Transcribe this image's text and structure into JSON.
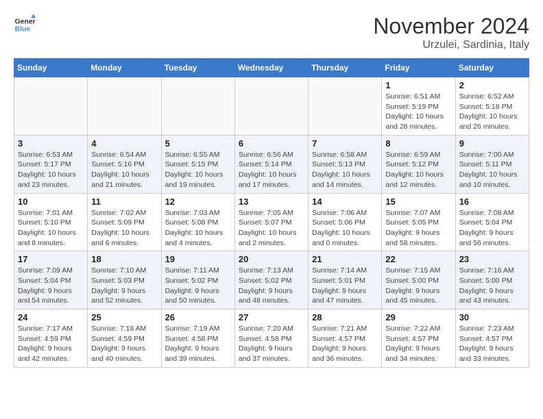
{
  "header": {
    "logo_line1": "General",
    "logo_line2": "Blue",
    "month_title": "November 2024",
    "location": "Urzulei, Sardinia, Italy"
  },
  "days_of_week": [
    "Sunday",
    "Monday",
    "Tuesday",
    "Wednesday",
    "Thursday",
    "Friday",
    "Saturday"
  ],
  "weeks": [
    [
      {
        "day": "",
        "info": ""
      },
      {
        "day": "",
        "info": ""
      },
      {
        "day": "",
        "info": ""
      },
      {
        "day": "",
        "info": ""
      },
      {
        "day": "",
        "info": ""
      },
      {
        "day": "1",
        "info": "Sunrise: 6:51 AM\nSunset: 5:19 PM\nDaylight: 10 hours\nand 28 minutes."
      },
      {
        "day": "2",
        "info": "Sunrise: 6:52 AM\nSunset: 5:18 PM\nDaylight: 10 hours\nand 26 minutes."
      }
    ],
    [
      {
        "day": "3",
        "info": "Sunrise: 6:53 AM\nSunset: 5:17 PM\nDaylight: 10 hours\nand 23 minutes."
      },
      {
        "day": "4",
        "info": "Sunrise: 6:54 AM\nSunset: 5:16 PM\nDaylight: 10 hours\nand 21 minutes."
      },
      {
        "day": "5",
        "info": "Sunrise: 6:55 AM\nSunset: 5:15 PM\nDaylight: 10 hours\nand 19 minutes."
      },
      {
        "day": "6",
        "info": "Sunrise: 6:56 AM\nSunset: 5:14 PM\nDaylight: 10 hours\nand 17 minutes."
      },
      {
        "day": "7",
        "info": "Sunrise: 6:58 AM\nSunset: 5:13 PM\nDaylight: 10 hours\nand 14 minutes."
      },
      {
        "day": "8",
        "info": "Sunrise: 6:59 AM\nSunset: 5:12 PM\nDaylight: 10 hours\nand 12 minutes."
      },
      {
        "day": "9",
        "info": "Sunrise: 7:00 AM\nSunset: 5:11 PM\nDaylight: 10 hours\nand 10 minutes."
      }
    ],
    [
      {
        "day": "10",
        "info": "Sunrise: 7:01 AM\nSunset: 5:10 PM\nDaylight: 10 hours\nand 8 minutes."
      },
      {
        "day": "11",
        "info": "Sunrise: 7:02 AM\nSunset: 5:09 PM\nDaylight: 10 hours\nand 6 minutes."
      },
      {
        "day": "12",
        "info": "Sunrise: 7:03 AM\nSunset: 5:08 PM\nDaylight: 10 hours\nand 4 minutes."
      },
      {
        "day": "13",
        "info": "Sunrise: 7:05 AM\nSunset: 5:07 PM\nDaylight: 10 hours\nand 2 minutes."
      },
      {
        "day": "14",
        "info": "Sunrise: 7:06 AM\nSunset: 5:06 PM\nDaylight: 10 hours\nand 0 minutes."
      },
      {
        "day": "15",
        "info": "Sunrise: 7:07 AM\nSunset: 5:05 PM\nDaylight: 9 hours\nand 58 minutes."
      },
      {
        "day": "16",
        "info": "Sunrise: 7:08 AM\nSunset: 5:04 PM\nDaylight: 9 hours\nand 56 minutes."
      }
    ],
    [
      {
        "day": "17",
        "info": "Sunrise: 7:09 AM\nSunset: 5:04 PM\nDaylight: 9 hours\nand 54 minutes."
      },
      {
        "day": "18",
        "info": "Sunrise: 7:10 AM\nSunset: 5:03 PM\nDaylight: 9 hours\nand 52 minutes."
      },
      {
        "day": "19",
        "info": "Sunrise: 7:11 AM\nSunset: 5:02 PM\nDaylight: 9 hours\nand 50 minutes."
      },
      {
        "day": "20",
        "info": "Sunrise: 7:13 AM\nSunset: 5:02 PM\nDaylight: 9 hours\nand 48 minutes."
      },
      {
        "day": "21",
        "info": "Sunrise: 7:14 AM\nSunset: 5:01 PM\nDaylight: 9 hours\nand 47 minutes."
      },
      {
        "day": "22",
        "info": "Sunrise: 7:15 AM\nSunset: 5:00 PM\nDaylight: 9 hours\nand 45 minutes."
      },
      {
        "day": "23",
        "info": "Sunrise: 7:16 AM\nSunset: 5:00 PM\nDaylight: 9 hours\nand 43 minutes."
      }
    ],
    [
      {
        "day": "24",
        "info": "Sunrise: 7:17 AM\nSunset: 4:59 PM\nDaylight: 9 hours\nand 42 minutes."
      },
      {
        "day": "25",
        "info": "Sunrise: 7:18 AM\nSunset: 4:59 PM\nDaylight: 9 hours\nand 40 minutes."
      },
      {
        "day": "26",
        "info": "Sunrise: 7:19 AM\nSunset: 4:58 PM\nDaylight: 9 hours\nand 39 minutes."
      },
      {
        "day": "27",
        "info": "Sunrise: 7:20 AM\nSunset: 4:58 PM\nDaylight: 9 hours\nand 37 minutes."
      },
      {
        "day": "28",
        "info": "Sunrise: 7:21 AM\nSunset: 4:57 PM\nDaylight: 9 hours\nand 36 minutes."
      },
      {
        "day": "29",
        "info": "Sunrise: 7:22 AM\nSunset: 4:57 PM\nDaylight: 9 hours\nand 34 minutes."
      },
      {
        "day": "30",
        "info": "Sunrise: 7:23 AM\nSunset: 4:57 PM\nDaylight: 9 hours\nand 33 minutes."
      }
    ]
  ]
}
